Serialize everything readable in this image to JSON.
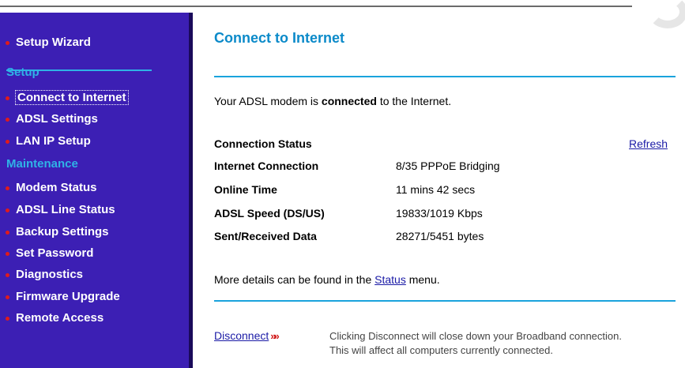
{
  "sidebar": {
    "top_item": "Setup Wizard",
    "setup_heading": "Setup",
    "setup_items": [
      "Connect to Internet",
      "ADSL Settings",
      "LAN IP Setup"
    ],
    "maintenance_heading": "Maintenance",
    "maintenance_items": [
      "Modem Status",
      "ADSL Line Status",
      "Backup Settings",
      "Set Password",
      "Diagnostics",
      "Firmware Upgrade",
      "Remote Access"
    ]
  },
  "main": {
    "title": "Connect to Internet",
    "status_prefix": "Your ADSL modem is ",
    "status_word": "connected",
    "status_suffix": " to the Internet.",
    "connection_status_label": "Connection Status",
    "refresh_label": "Refresh",
    "rows": [
      {
        "label": "Internet Connection",
        "value": "8/35  PPPoE Bridging"
      },
      {
        "label": "Online Time",
        "value": "11 mins 42 secs"
      },
      {
        "label": "ADSL Speed (DS/US)",
        "value": "19833/1019 Kbps"
      },
      {
        "label": "Sent/Received Data",
        "value": "28271/5451 bytes"
      }
    ],
    "details_prefix": "More details can be found in the ",
    "details_link": "Status",
    "details_suffix": " menu.",
    "disconnect_label": "Disconnect",
    "disconnect_note_line1": "Clicking Disconnect will close down your Broadband connection.",
    "disconnect_note_line2": "This will affect all computers currently connected."
  },
  "colors": {
    "sidebar_bg": "#3c1fb4",
    "heading": "#2fb3e6",
    "title": "#0b8ac9",
    "bullet": "#e01b1b"
  }
}
